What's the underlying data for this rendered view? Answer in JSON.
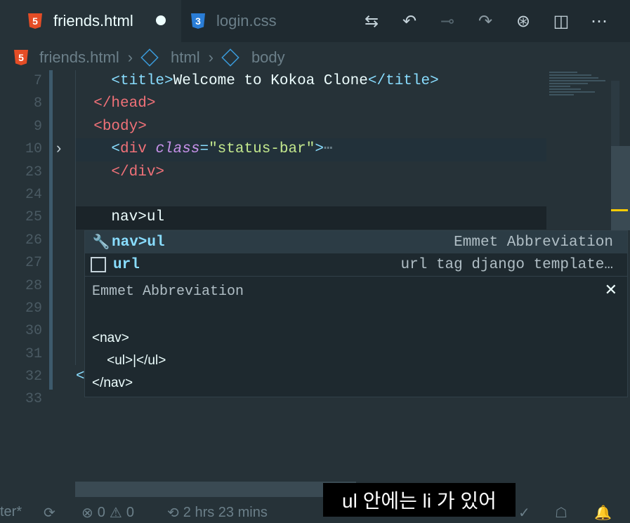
{
  "tabs": [
    {
      "label": "friends.html",
      "icon": "html5-icon",
      "modified": true
    },
    {
      "label": "login.css",
      "icon": "css3-icon"
    }
  ],
  "toolbar": [
    "compare-icon",
    "go-back-icon",
    "commit-icon",
    "go-forward-icon",
    "git-graph-icon",
    "split-editor-icon",
    "more-icon"
  ],
  "breadcrumb": [
    "friends.html",
    "html",
    "body"
  ],
  "line_numbers": [
    "7",
    "8",
    "9",
    "10",
    "23",
    "24",
    "25",
    "26",
    "27",
    "28",
    "29",
    "30",
    "31",
    "32",
    "33"
  ],
  "code": {
    "l7": {
      "open": "<title>",
      "text": "Welcome to Kokoa Clone",
      "close": "</title>"
    },
    "l8": "</head>",
    "l9": "<body>",
    "l10": {
      "tag": "div",
      "attr": "class",
      "value": "\"status-bar\""
    },
    "l23": "</div>",
    "l25": "nav>ul",
    "l32": "<"
  },
  "suggest": {
    "items": [
      {
        "label": "nav>ul",
        "detail": "Emmet Abbreviation",
        "icon": "wrench-icon"
      },
      {
        "label": "url",
        "detail": "url tag django template…",
        "icon": "snippet-icon"
      }
    ],
    "doc_title": "Emmet Abbreviation",
    "doc_lines": [
      "<nav>",
      "    <ul>|</ul>",
      "</nav>"
    ]
  },
  "status": {
    "left": "ter*",
    "errors": "0",
    "warnings": "0",
    "time": "2 hrs 23 mins"
  },
  "caption": "ul 안에는 li 가 있어",
  "colors": {
    "background": "#263238",
    "tag": "#f07178",
    "punct": "#89ddff",
    "attr": "#c792ea",
    "string": "#c3e88d"
  }
}
